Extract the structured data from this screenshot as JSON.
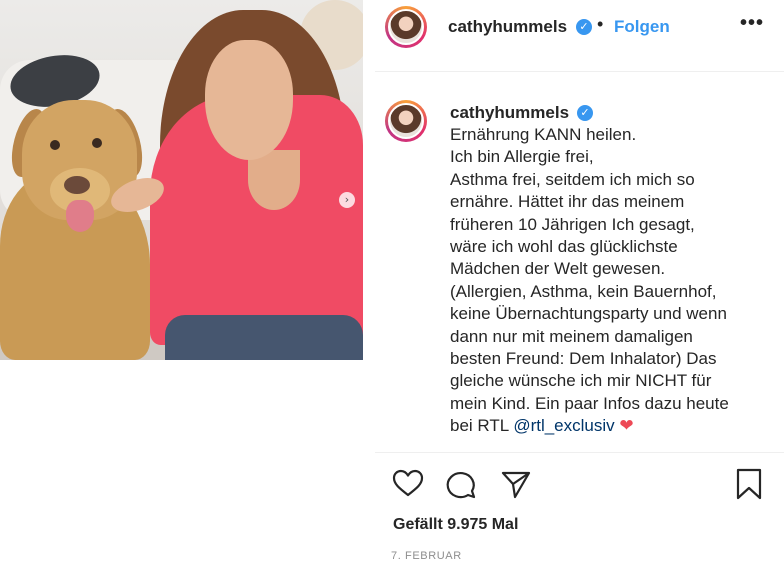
{
  "post": {
    "username": "cathyhummels",
    "verified_mark": "✓",
    "follow_label": "Folgen",
    "separator": "•",
    "more_label": "•••",
    "carousel_next": "›"
  },
  "caption": {
    "username": "cathyhummels",
    "lines": [
      "Ernährung KANN heilen.",
      "Ich bin Allergie frei,",
      "Asthma frei, seitdem ich mich so",
      "ernähre. Hättet ihr das meinem",
      "früheren 10 Jährigen Ich gesagt,",
      "wäre ich wohl das glücklichste",
      "Mädchen der Welt gewesen.",
      "(Allergien, Asthma, kein Bauernhof,",
      "keine Übernachtungsparty und wenn",
      "dann nur mit meinem damaligen",
      "besten Freund: Dem Inhalator) Das",
      "gleiche wünsche ich mir NICHT für",
      "mein Kind. Ein paar Infos dazu heute"
    ],
    "last_line_prefix": "bei RTL ",
    "mention": "@rtl_exclusiv",
    "emoji": "❤"
  },
  "actions": {
    "icons": [
      "heart-icon",
      "comment-icon",
      "share-icon",
      "bookmark-icon"
    ]
  },
  "likes_text": "Gefällt 9.975 Mal",
  "date_text": "7. FEBRUAR",
  "colors": {
    "link_blue": "#3897f0",
    "mention": "#003569",
    "text": "#262626",
    "muted": "#8e8e8e",
    "sweater": "#f04b64"
  }
}
